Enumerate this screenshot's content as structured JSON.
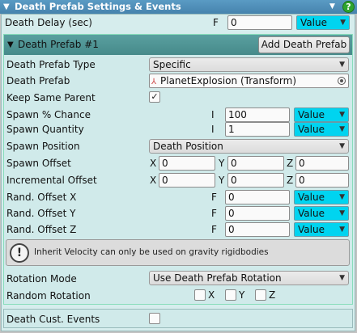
{
  "header": {
    "title": "Death Prefab Settings & Events",
    "help": "?"
  },
  "death_delay": {
    "label": "Death Delay (sec)",
    "type_letter": "F",
    "value": "0",
    "mode": "Value"
  },
  "prefab_section": {
    "title": "Death Prefab #1",
    "add_button": "Add Death Prefab",
    "type": {
      "label": "Death Prefab Type",
      "value": "Specific"
    },
    "prefab": {
      "label": "Death Prefab",
      "value": "PlanetExplosion (Transform)"
    },
    "keep_parent": {
      "label": "Keep Same Parent",
      "checked": "✓"
    },
    "spawn_chance": {
      "label": "Spawn % Chance",
      "type_letter": "I",
      "value": "100",
      "mode": "Value"
    },
    "spawn_quantity": {
      "label": "Spawn Quantity",
      "type_letter": "I",
      "value": "1",
      "mode": "Value"
    },
    "spawn_position": {
      "label": "Spawn Position",
      "value": "Death Position"
    },
    "spawn_offset": {
      "label": "Spawn Offset",
      "x_label": "X",
      "x": "0",
      "y_label": "Y",
      "y": "0",
      "z_label": "Z",
      "z": "0"
    },
    "incremental_offset": {
      "label": "Incremental Offset",
      "x_label": "X",
      "x": "0",
      "y_label": "Y",
      "y": "0",
      "z_label": "Z",
      "z": "0"
    },
    "rand_x": {
      "label": "Rand. Offset X",
      "type_letter": "F",
      "value": "0",
      "mode": "Value"
    },
    "rand_y": {
      "label": "Rand. Offset Y",
      "type_letter": "F",
      "value": "0",
      "mode": "Value"
    },
    "rand_z": {
      "label": "Rand. Offset Z",
      "type_letter": "F",
      "value": "0",
      "mode": "Value"
    },
    "info": {
      "icon": "!",
      "text": "Inherit Velocity can only be used on gravity rigidbodies"
    },
    "rotation_mode": {
      "label": "Rotation Mode",
      "value": "Use Death Prefab Rotation"
    },
    "random_rotation": {
      "label": "Random Rotation",
      "x_label": "X",
      "y_label": "Y",
      "z_label": "Z"
    }
  },
  "custom_events": {
    "label": "Death Cust. Events"
  },
  "colors": {
    "header_bg": "#4f91bb",
    "section_bg": "#d4ecec",
    "section_header": "#4d9191",
    "value_dropdown": "#00d4f0"
  }
}
